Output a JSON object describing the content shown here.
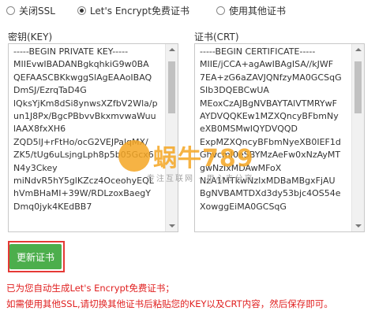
{
  "ssl_options": [
    {
      "label": "关闭SSL",
      "selected": false
    },
    {
      "label": "Let's Encrypt免费证书",
      "selected": true
    },
    {
      "label": "使用其他证书",
      "selected": false
    }
  ],
  "key_field": {
    "label": "密钥(KEY)",
    "lines": [
      "-----BEGIN PRIVATE KEY-----",
      "MIIEvwIBADANBgkqhkiG9w0BA",
      "QEFAASCBKkwggSlAgEAAoIBAQ",
      "DmSJ/EzrqTaD4G",
      "lQksYjKm8dSi8ynwsXZfbV2Wla/p",
      "un1J8Px/BgcPBbvvBkxmvwaWuu",
      "lAAX8fxXH6",
      "ZQD5lJ+rFtHo/ocG2VEJPalqMX/",
      "ZK5/tUg6uLsjngLph8p5b05Gcx6",
      "N4y3Ckey",
      "miNdvR5hY5glKZcz4OceohyEQL",
      "hVmBHaMI+39W/RDLzoxBaegY",
      "Dmq0jyk4KEdBB7"
    ]
  },
  "crt_field": {
    "label": "证书(CRT)",
    "lines": [
      "-----BEGIN CERTIFICATE-----",
      "MIIE/jCCA+agAwIBAgISA//kJWF",
      "7EA+zG6aZAVJQNfzyMA0GCSqG",
      "SIb3DQEBCwUA",
      "MEoxCzAJBgNVBAYTAlVTMRYwF",
      "AYDVQQKEw1MZXQncyBFbmNy",
      "eXB0MSMwIQYDVQQD",
      "ExpMZXQncyBFbmNyeXB0IEF1d",
      "GhvcmI0eSBYMzAeFw0xNzAyMT",
      "gwNzIxMDAwMFoX",
      "NzA1MTkwNzIxMDBaMBgxFjAU",
      "BgNVBAMTDXd3dy53bjc4OS54e",
      "XowggEiMA0GCSqG"
    ]
  },
  "watermark": {
    "title": "蜗牛789",
    "subtitle": "专注互联网 · 用心去分享"
  },
  "update_button": "更新证书",
  "notes": [
    "已为您自动生成Let's Encrypt免费证书；",
    "如需使用其他SSL,请切换其他证书后粘贴您的KEY以及CRT内容，然后保存即可。"
  ],
  "colors": {
    "button_green": "#4cae4c",
    "highlight_red": "#e53935",
    "note_red": "#e02020",
    "watermark_orange": "#f5a623"
  }
}
